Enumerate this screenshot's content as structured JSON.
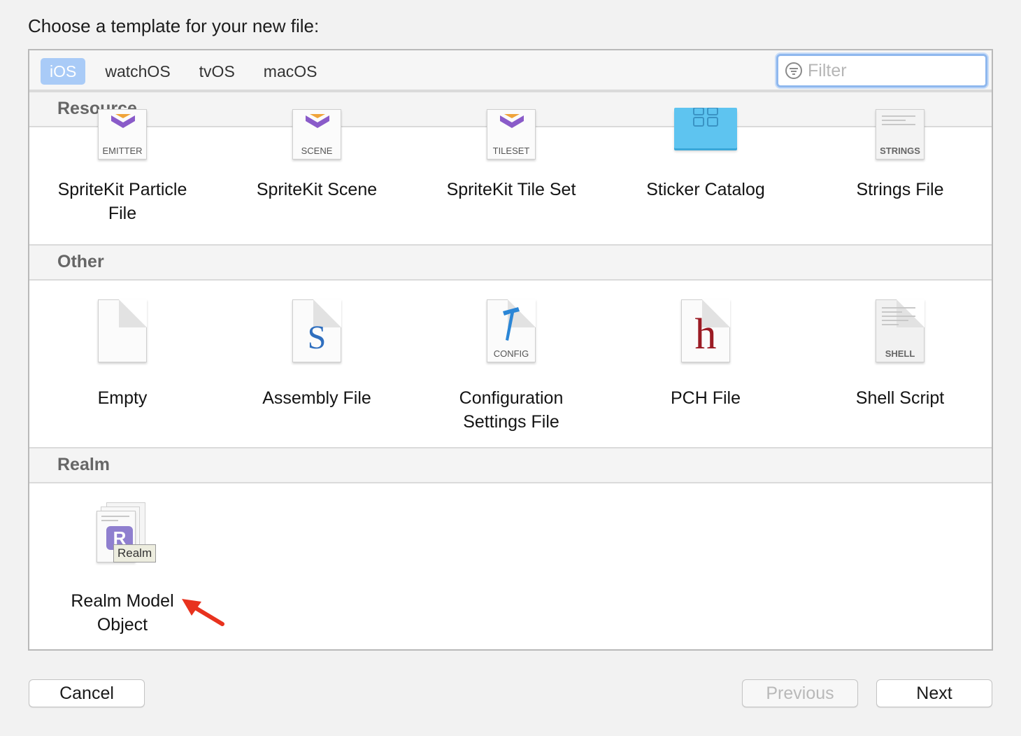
{
  "dialog": {
    "prompt": "Choose a template for your new file:"
  },
  "platform_tabs": [
    {
      "label": "iOS",
      "selected": true
    },
    {
      "label": "watchOS",
      "selected": false
    },
    {
      "label": "tvOS",
      "selected": false
    },
    {
      "label": "macOS",
      "selected": false
    }
  ],
  "filter": {
    "placeholder": "Filter",
    "value": "",
    "icon": "filter-icon"
  },
  "sections": {
    "resource": {
      "title": "Resource",
      "items": [
        {
          "label_line1": "SpriteKit Particle",
          "label_line2": "File",
          "icon": "spritekit-emitter-icon",
          "icon_tag": "EMITTER"
        },
        {
          "label_line1": "SpriteKit Scene",
          "label_line2": "",
          "icon": "spritekit-scene-icon",
          "icon_tag": "SCENE"
        },
        {
          "label_line1": "SpriteKit Tile Set",
          "label_line2": "",
          "icon": "spritekit-tileset-icon",
          "icon_tag": "TILESET"
        },
        {
          "label_line1": "Sticker Catalog",
          "label_line2": "",
          "icon": "sticker-catalog-icon",
          "icon_tag": ""
        },
        {
          "label_line1": "Strings File",
          "label_line2": "",
          "icon": "strings-file-icon",
          "icon_tag": "STRINGS"
        }
      ]
    },
    "other": {
      "title": "Other",
      "items": [
        {
          "label_line1": "Empty",
          "label_line2": "",
          "icon": "empty-file-icon",
          "icon_tag": ""
        },
        {
          "label_line1": "Assembly File",
          "label_line2": "",
          "icon": "assembly-file-icon",
          "icon_glyph": "S"
        },
        {
          "label_line1": "Configuration",
          "label_line2": "Settings File",
          "icon": "config-file-icon",
          "icon_tag": "CONFIG"
        },
        {
          "label_line1": "PCH File",
          "label_line2": "",
          "icon": "pch-file-icon",
          "icon_glyph": "h"
        },
        {
          "label_line1": "Shell Script",
          "label_line2": "",
          "icon": "shell-script-icon",
          "icon_tag": "SHELL"
        }
      ]
    },
    "realm": {
      "title": "Realm",
      "items": [
        {
          "label_line1": "Realm Model",
          "label_line2": "Object",
          "icon": "realm-model-icon",
          "icon_glyph": "R",
          "icon_tag": "Realm"
        }
      ]
    }
  },
  "annotation": {
    "icon": "red-arrow-icon",
    "color": "#e8321e"
  },
  "buttons": {
    "cancel": "Cancel",
    "previous": "Previous",
    "next": "Next",
    "previous_enabled": false
  },
  "colors": {
    "selected_tab": "#a9cbf7",
    "filter_focus": "#8fb8ee",
    "spritekit_purple": "#8a5bc9",
    "spritekit_orange": "#f0a43a",
    "sticker_blue": "#5ec4f0",
    "pch_red": "#9b1b24",
    "assembly_blue": "#2f6fbf",
    "config_blue": "#2b86d6",
    "realm_purple": "#8f7fcf"
  }
}
